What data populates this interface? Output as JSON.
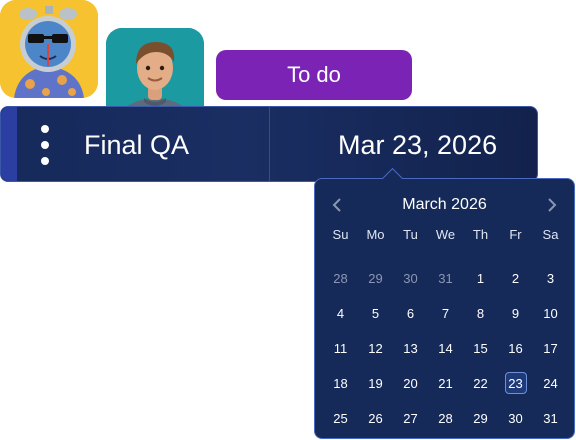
{
  "avatars": [
    {
      "name": "clock-mascot-avatar"
    },
    {
      "name": "man-3d-avatar"
    }
  ],
  "status": {
    "label": "To do",
    "color": "#7a23b4"
  },
  "task": {
    "title": "Final QA",
    "due_date": "Mar 23, 2026",
    "menu_icon": "kebab-menu-icon"
  },
  "date_picker": {
    "month_label": "March 2026",
    "prev_icon": "chevron-left-icon",
    "next_icon": "chevron-right-icon",
    "weekdays": [
      "Su",
      "Mo",
      "Tu",
      "We",
      "Th",
      "Fr",
      "Sa"
    ],
    "days": [
      {
        "label": "28",
        "muted": true
      },
      {
        "label": "29",
        "muted": true
      },
      {
        "label": "30",
        "muted": true
      },
      {
        "label": "31",
        "muted": true
      },
      {
        "label": "1"
      },
      {
        "label": "2"
      },
      {
        "label": "3"
      },
      {
        "label": "4"
      },
      {
        "label": "5"
      },
      {
        "label": "6"
      },
      {
        "label": "7"
      },
      {
        "label": "8"
      },
      {
        "label": "9"
      },
      {
        "label": "10"
      },
      {
        "label": "11"
      },
      {
        "label": "12"
      },
      {
        "label": "13"
      },
      {
        "label": "14"
      },
      {
        "label": "15"
      },
      {
        "label": "16"
      },
      {
        "label": "17"
      },
      {
        "label": "18"
      },
      {
        "label": "19"
      },
      {
        "label": "20"
      },
      {
        "label": "21"
      },
      {
        "label": "22"
      },
      {
        "label": "23",
        "selected": true
      },
      {
        "label": "24"
      },
      {
        "label": "25"
      },
      {
        "label": "26"
      },
      {
        "label": "27"
      },
      {
        "label": "28"
      },
      {
        "label": "29"
      },
      {
        "label": "30"
      },
      {
        "label": "31"
      }
    ],
    "colors": {
      "background": "#152a58",
      "border": "#4a6bbf",
      "muted_text": "#8c96b4"
    }
  }
}
